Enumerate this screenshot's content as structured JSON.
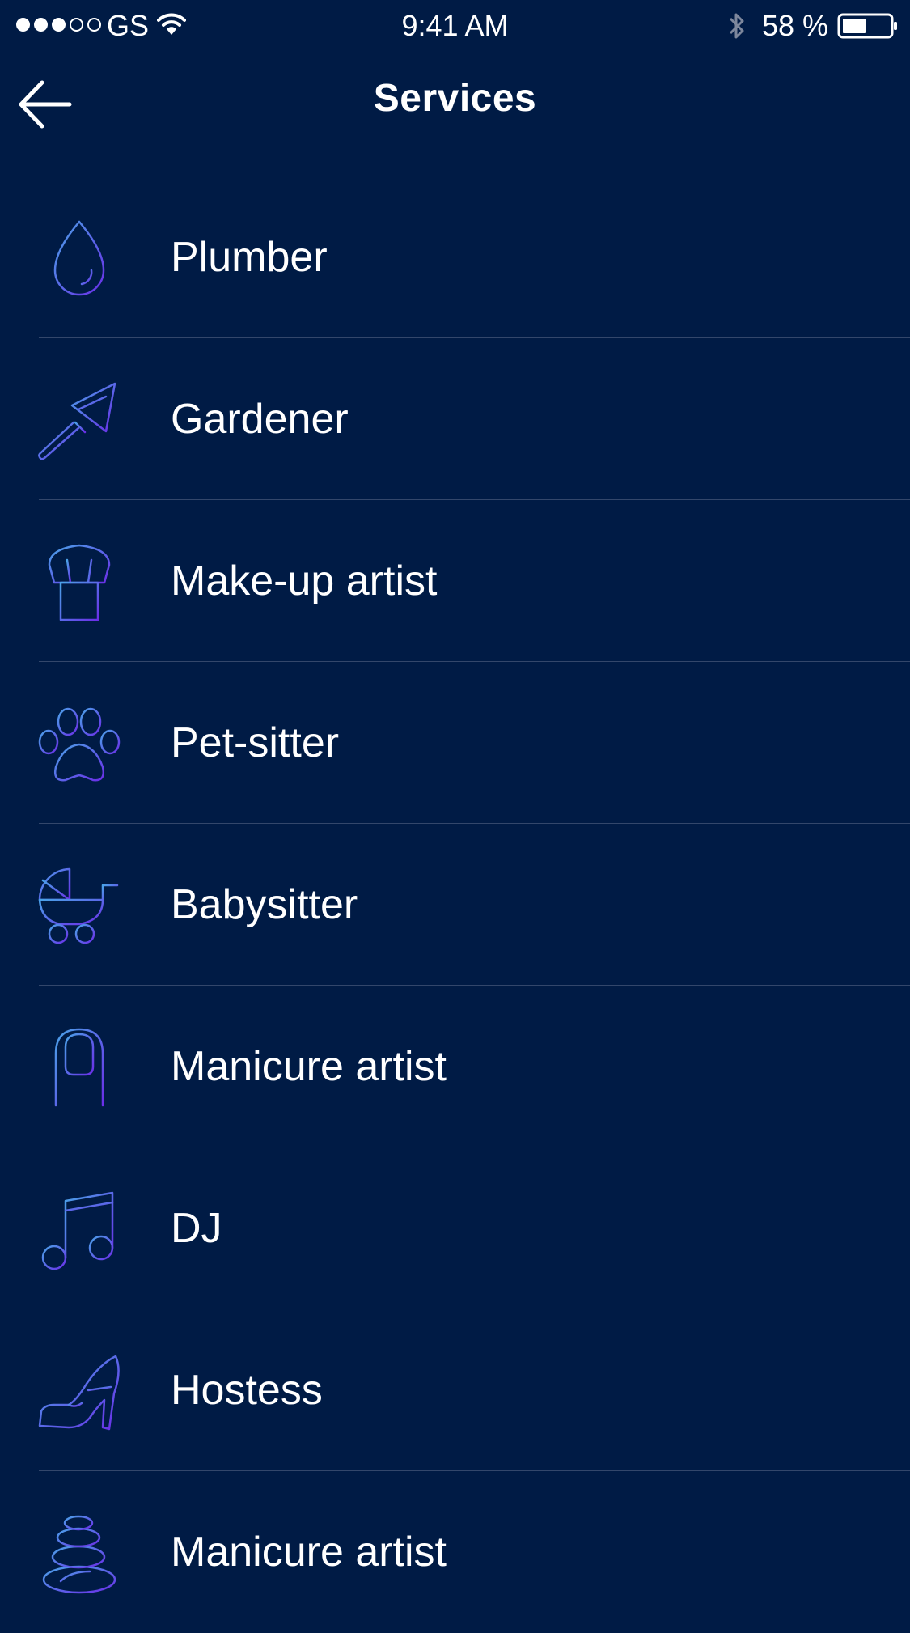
{
  "status_bar": {
    "carrier": "GS",
    "time": "9:41 AM",
    "battery": "58 %",
    "signal_bars_filled": 3,
    "signal_bars_total": 5,
    "battery_level": 0.58
  },
  "header": {
    "title": "Services",
    "back_icon": "arrow-left-icon"
  },
  "colors": {
    "background": "#001b45",
    "divider": "#33476b",
    "icon_gradient_start": "#4aa3e8",
    "icon_gradient_end": "#6a2ee8"
  },
  "services": [
    {
      "label": "Plumber",
      "icon": "water-drop-icon"
    },
    {
      "label": "Gardener",
      "icon": "trowel-icon"
    },
    {
      "label": "Make-up artist",
      "icon": "makeup-brush-icon"
    },
    {
      "label": "Pet-sitter",
      "icon": "paw-icon"
    },
    {
      "label": "Babysitter",
      "icon": "stroller-icon"
    },
    {
      "label": "Manicure artist",
      "icon": "fingernail-icon"
    },
    {
      "label": "DJ",
      "icon": "music-note-icon"
    },
    {
      "label": "Hostess",
      "icon": "high-heel-icon"
    },
    {
      "label": "Manicure artist",
      "icon": "spa-stones-icon"
    }
  ]
}
